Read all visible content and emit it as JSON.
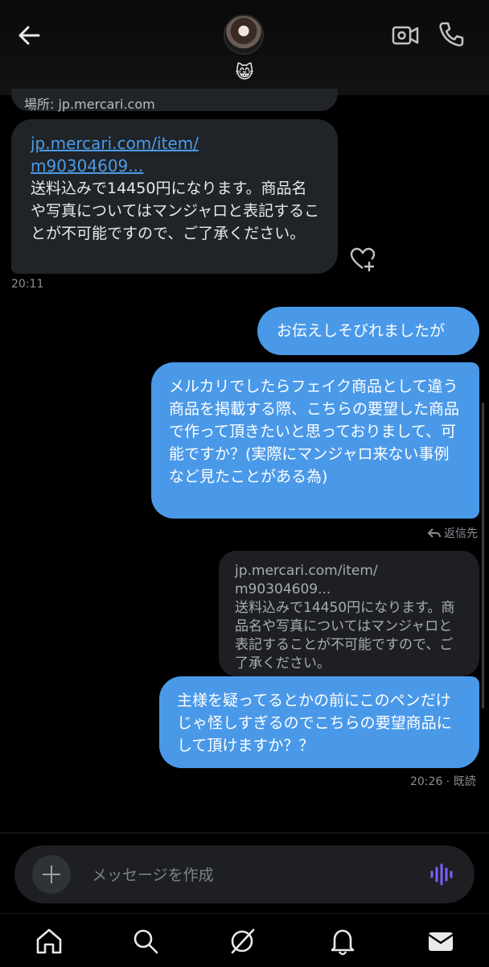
{
  "header": {
    "avatar_emoji": "😸",
    "icons": [
      "back-arrow-icon",
      "video-camera-icon",
      "phone-icon"
    ]
  },
  "messages": {
    "prev_location": "場所: jp.mercari.com",
    "incoming_link": "jp.mercari.com/item/\nm90304609...",
    "incoming_text": "送料込みで14450円になります。商品名や写真についてはマンジャロと表記することが不可能ですので、ご了承ください。",
    "incoming_time": "20:11",
    "out1": "お伝えしそびれましたが",
    "out2": "メルカリでしたらフェイク商品として違う商品を掲載する際、こちらの要望した商品で作って頂きたいと思っておりまして、可能ですか？(実際にマンジャロ来ない事例など見たことがある為)",
    "reply_label": "返信先",
    "quoted": "jp.mercari.com/item/\nm90304609...\n送料込みで14450円になります。商品名や写真についてはマンジャロと表記することが不可能ですので、ご了承ください。",
    "out3": "主様を疑ってるとかの前にこのペンだけじゃ怪しすぎるのでこちらの要望商品にして頂けますか？？",
    "out3_status": "20:26 · 既読"
  },
  "composer": {
    "placeholder": "メッセージを作成"
  },
  "colors": {
    "outgoing_bubble": "#4a99e9",
    "incoming_bubble": "#202327",
    "link": "#4b9ce8",
    "audio_icon": "#7b61ff"
  },
  "tabbar": {
    "icons": [
      "home-icon",
      "search-icon",
      "grok-icon",
      "notifications-icon",
      "messages-icon"
    ]
  }
}
